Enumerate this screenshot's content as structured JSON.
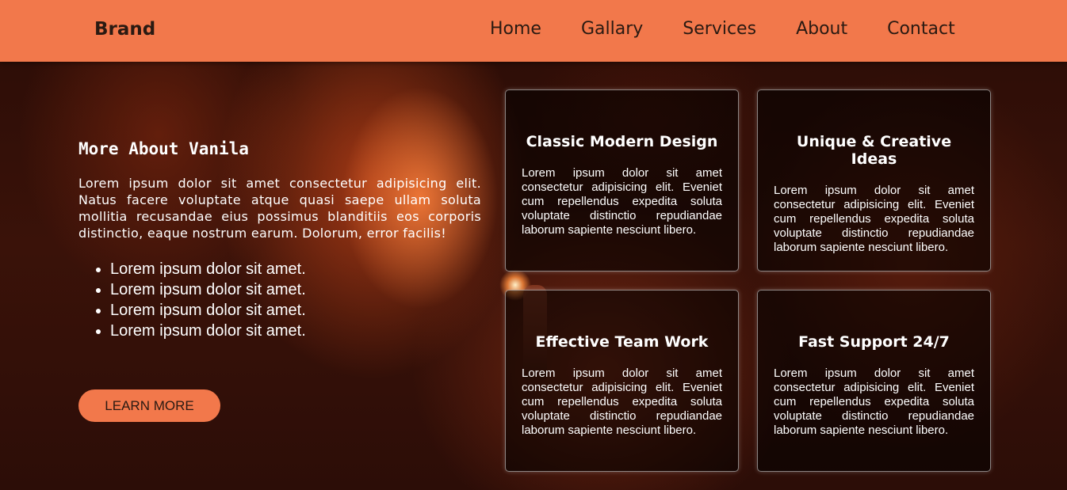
{
  "navbar": {
    "brand": "Brand",
    "links": [
      "Home",
      "Gallary",
      "Services",
      "About",
      "Contact"
    ]
  },
  "about": {
    "title": "More About Vanila",
    "paragraph": "Lorem ipsum dolor sit amet consectetur adipisicing elit. Natus facere voluptate atque quasi saepe ullam soluta mollitia recusandae eius possimus blanditiis eos corporis distinctio, eaque nostrum earum. Dolorum, error facilis!",
    "bullets": [
      "Lorem ipsum dolor sit amet.",
      "Lorem ipsum dolor sit amet.",
      "Lorem ipsum dolor sit amet.",
      "Lorem ipsum dolor sit amet."
    ],
    "button": "LEARN MORE"
  },
  "cards": [
    {
      "title": "Classic Modern Design",
      "text": "Lorem ipsum dolor sit amet consectetur adipisicing elit. Eveniet cum repellendus expedita soluta voluptate distinctio repudiandae laborum sapiente nesciunt libero."
    },
    {
      "title": "Unique & Creative Ideas",
      "text": "Lorem ipsum dolor sit amet consectetur adipisicing elit. Eveniet cum repellendus expedita soluta voluptate distinctio repudiandae laborum sapiente nesciunt libero."
    },
    {
      "title": "Effective Team Work",
      "text": "Lorem ipsum dolor sit amet consectetur adipisicing elit. Eveniet cum repellendus expedita soluta voluptate distinctio repudiandae laborum sapiente nesciunt libero."
    },
    {
      "title": "Fast Support 24/7",
      "text": "Lorem ipsum dolor sit amet consectetur adipisicing elit. Eveniet cum repellendus expedita soluta voluptate distinctio repudiandae laborum sapiente nesciunt libero."
    }
  ],
  "colors": {
    "accent": "#f2784b",
    "text_dark": "#2a1a12",
    "text_light": "#ffffff"
  }
}
